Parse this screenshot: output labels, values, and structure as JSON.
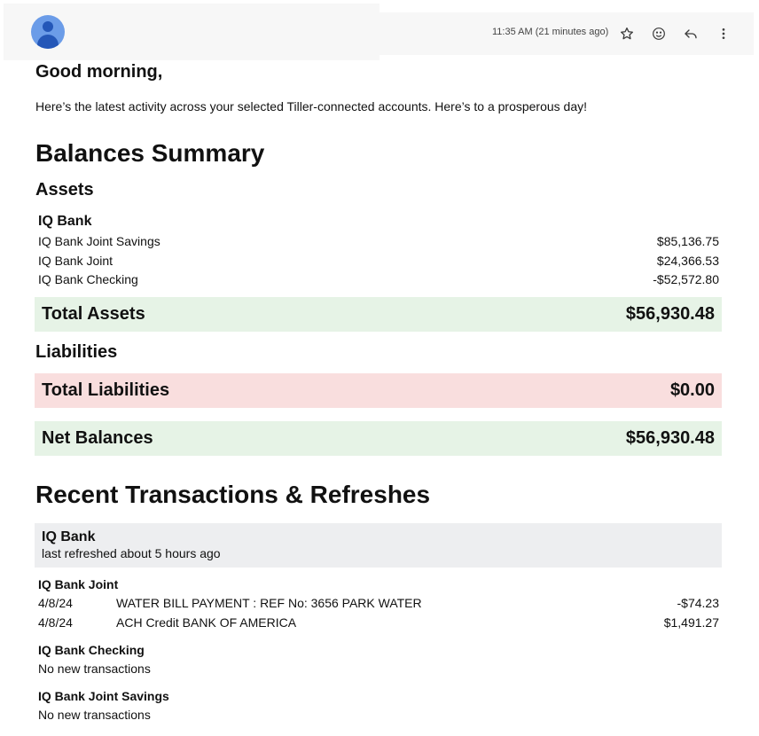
{
  "header": {
    "time": "11:35 AM (21 minutes ago)"
  },
  "greeting": "Good morning,",
  "intro": "Here’s the latest activity across your selected Tiller-connected accounts. Here’s to a prosperous day!",
  "balances": {
    "title": "Balances Summary",
    "assets_title": "Assets",
    "bank": "IQ Bank",
    "accounts": [
      {
        "name": "IQ Bank Joint Savings",
        "amount": "$85,136.75"
      },
      {
        "name": "IQ Bank Joint",
        "amount": "$24,366.53"
      },
      {
        "name": "IQ Bank Checking",
        "amount": "-$52,572.80"
      }
    ],
    "total_assets_label": "Total Assets",
    "total_assets": "$56,930.48",
    "liabilities_title": "Liabilities",
    "total_liabilities_label": "Total Liabilities",
    "total_liabilities": "$0.00",
    "net_label": "Net Balances",
    "net": "$56,930.48"
  },
  "recent": {
    "title": "Recent Transactions & Refreshes",
    "bank": "IQ Bank",
    "refreshed": "last refreshed about 5 hours ago",
    "joint": {
      "name": "IQ Bank Joint",
      "transactions": [
        {
          "date": "4/8/24",
          "desc": "WATER BILL PAYMENT : REF No: 3656 PARK WATER",
          "amount": "-$74.23"
        },
        {
          "date": "4/8/24",
          "desc": "ACH Credit BANK OF AMERICA",
          "amount": "$1,491.27"
        }
      ]
    },
    "checking": {
      "name": "IQ Bank Checking",
      "none": "No new transactions"
    },
    "savings": {
      "name": "IQ Bank Joint Savings",
      "none": "No new transactions"
    }
  },
  "icons": [
    "avatar",
    "star-icon",
    "emoji-icon",
    "reply-icon",
    "more-vert-icon"
  ]
}
